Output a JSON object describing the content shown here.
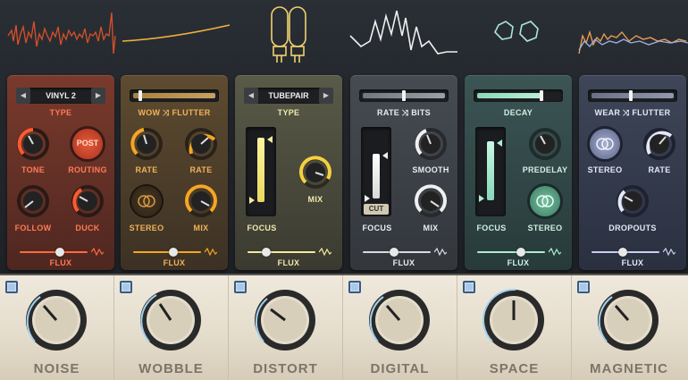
{
  "panels": {
    "noise": {
      "selector_value": "VINYL 2",
      "selector_label": "TYPE",
      "tone_label": "TONE",
      "routing_label": "ROUTING",
      "routing_button": "POST",
      "follow_label": "FOLLOW",
      "duck_label": "DUCK",
      "flux_label": "FLUX"
    },
    "wobble": {
      "slider_label_left": "WOW",
      "slider_label_right": "FLUTTER",
      "rate_left_label": "RATE",
      "rate_right_label": "RATE",
      "stereo_label": "STEREO",
      "mix_label": "MIX",
      "flux_label": "FLUX"
    },
    "distort": {
      "selector_value": "TUBEPAIR",
      "selector_label": "TYPE",
      "focus_label": "FOCUS",
      "mix_label": "MIX",
      "flux_label": "FLUX"
    },
    "digital": {
      "slider_label_left": "RATE",
      "slider_label_right": "BITS",
      "smooth_label": "SMOOTH",
      "focus_label": "FOCUS",
      "cut_label": "CUT",
      "mix_label": "MIX",
      "flux_label": "FLUX"
    },
    "space": {
      "slider_label": "DECAY",
      "predelay_label": "PREDELAY",
      "focus_label": "FOCUS",
      "stereo_label": "STEREO",
      "flux_label": "FLUX"
    },
    "magnetic": {
      "slider_label_left": "WEAR",
      "slider_label_right": "FLUTTER",
      "stereo_label": "STEREO",
      "rate_label": "RATE",
      "dropouts_label": "DROPOUTS",
      "flux_label": "FLUX"
    }
  },
  "modules": [
    {
      "name": "NOISE"
    },
    {
      "name": "WOBBLE"
    },
    {
      "name": "DISTORT"
    },
    {
      "name": "DIGITAL"
    },
    {
      "name": "SPACE"
    },
    {
      "name": "MAGNETIC"
    }
  ],
  "colors": {
    "noise": "#ff5a30",
    "wobble": "#f5a623",
    "distort": "#f5eaa0",
    "digital": "#f0f0f0",
    "space": "#a8f0d0",
    "magnetic": "#c8d0f0"
  }
}
